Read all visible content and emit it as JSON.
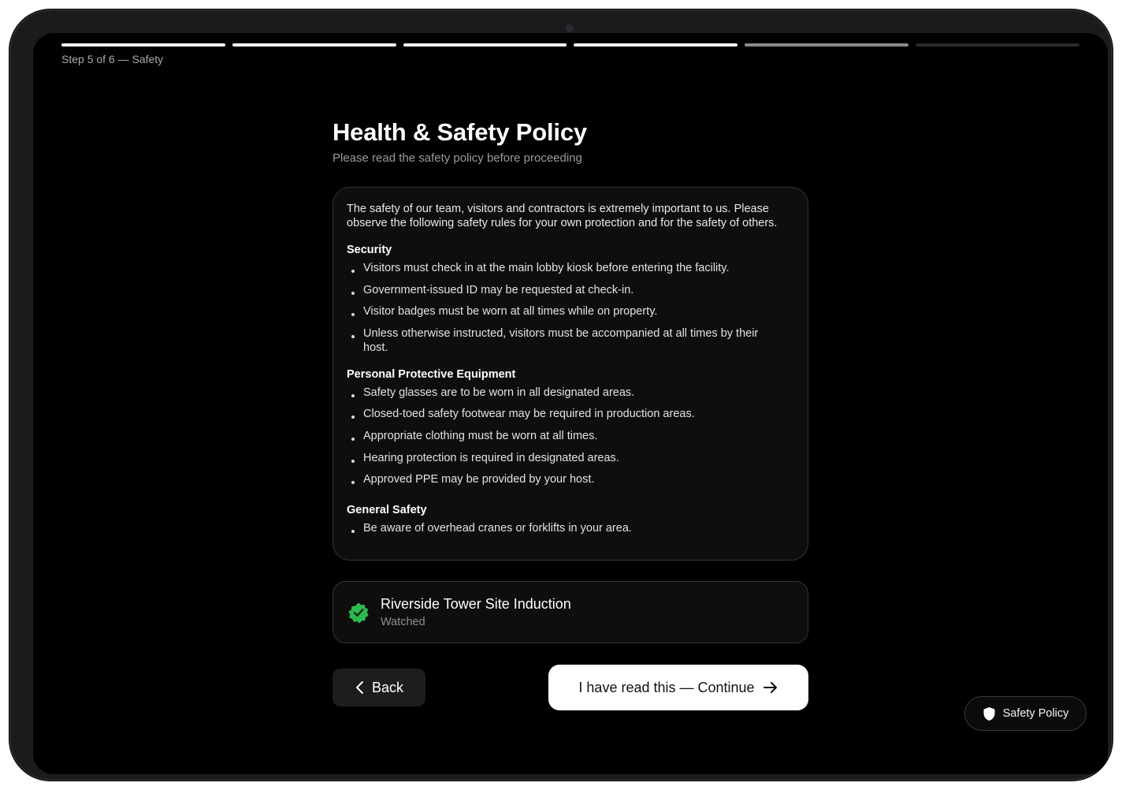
{
  "progress": {
    "steps": [
      {
        "state": "done"
      },
      {
        "state": "done"
      },
      {
        "state": "done"
      },
      {
        "state": "done"
      },
      {
        "state": "current"
      },
      {
        "state": "upcoming"
      }
    ],
    "label": "Step 5 of 6 — Safety"
  },
  "page": {
    "title": "Health & Safety Policy",
    "subtitle": "Please read the safety policy before proceeding"
  },
  "policy": {
    "intro": "The safety of our team, visitors and contractors is extremely important to us. Please observe the following safety rules for your own protection and for the safety of others.",
    "sections": [
      {
        "title": "Security",
        "items": [
          "Visitors must check in at the main lobby kiosk before entering the facility.",
          "Government-issued ID may be requested at check-in.",
          "Visitor badges must be worn at all times while on property.",
          "Unless otherwise instructed, visitors must be accompanied at all times by their host."
        ]
      },
      {
        "title": "Personal Protective Equipment",
        "items": [
          "Safety glasses are to be worn in all designated areas.",
          "Closed-toed safety footwear may be required in production areas.",
          "Appropriate clothing must be worn at all times.",
          "Hearing protection is required in designated areas.",
          "Approved PPE may be provided by your host."
        ]
      },
      {
        "title": "General Safety",
        "items": [
          "Be aware of overhead cranes or forklifts in your area."
        ]
      }
    ]
  },
  "video": {
    "title": "Riverside Tower Site Induction",
    "status": "Watched",
    "badge_icon": "verified-check-icon",
    "badge_color": "#2fb84f"
  },
  "actions": {
    "back_label": "Back",
    "back_icon": "chevron-left-icon",
    "continue_label": "I have read this — Continue",
    "continue_icon": "arrow-right-icon"
  },
  "chip": {
    "label": "Safety Policy",
    "icon": "shield-icon"
  },
  "colors": {
    "background": "#000000",
    "progress_done": "#f4f4f4",
    "progress_current": "#8a8a8d",
    "progress_upcoming": "#2a2a2c",
    "primary_button": "#ffffff"
  }
}
